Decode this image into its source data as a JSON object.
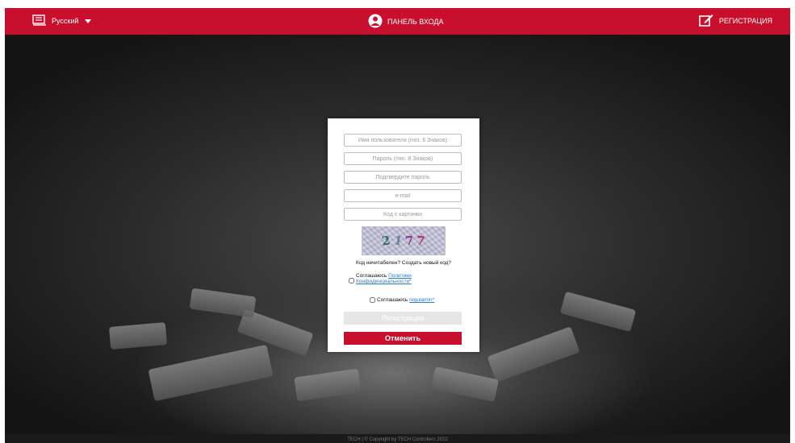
{
  "header": {
    "language_label": "Русский",
    "login_panel_label": "ПАНЕЛЬ ВХОДА",
    "register_label": "РЕГИСТРАЦИЯ"
  },
  "form": {
    "username_placeholder": "Имя пользователя (min. 6 Знаков)",
    "password_placeholder": "Пароль (min. 8 Знаков)",
    "confirm_password_placeholder": "Подтвердите пароль",
    "email_placeholder": "e-mail",
    "captcha_code_placeholder": "Код с картинки",
    "captcha_chars": [
      "2",
      "1",
      "7",
      "7"
    ],
    "captcha_unreadable": "Код нечитабелен?",
    "captcha_new_code": "Создать новый код?",
    "privacy_agree_prefix": "Соглашаюсь",
    "privacy_link_text": "Политики Конфиденциальности*",
    "regulations_agree_prefix": "Соглашаюсь",
    "regulations_link_text": "regulamin*",
    "register_button": "Регистрация",
    "cancel_button": "Отменить"
  },
  "footer": {
    "copyright": "TECH | © Copyright by TECH Controllers 2022"
  },
  "colors": {
    "brand_red": "#c8102e",
    "link_blue": "#2a7bd4",
    "disabled_button": "#e6e6e6"
  }
}
